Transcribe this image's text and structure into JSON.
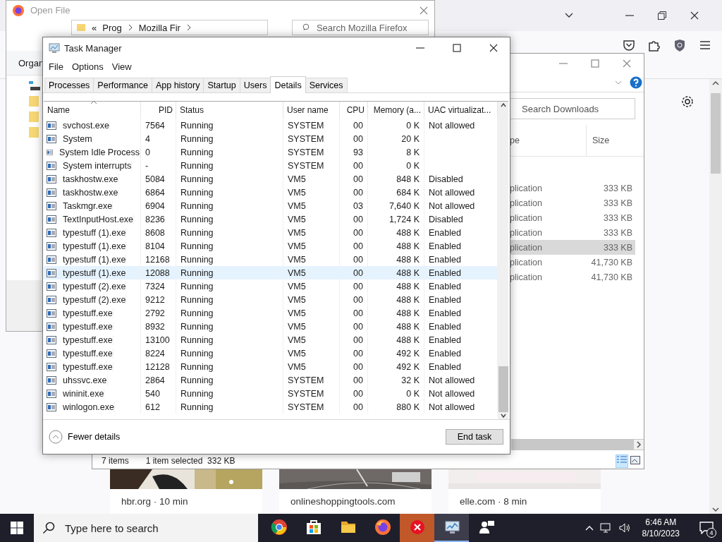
{
  "browser": {
    "cards": [
      {
        "caption": "hbr.org · 10 min"
      },
      {
        "caption": "onlineshoppingtools.com"
      },
      {
        "caption": "elle.com · 8 min"
      }
    ]
  },
  "open_file": {
    "title": "Open File",
    "path": {
      "overflow": "«",
      "segments": [
        "Prog",
        "Mozilla Fir"
      ]
    },
    "search": {
      "placeholder": "Search Mozilla Firefox"
    },
    "organize": "Organ"
  },
  "downloads": {
    "search": {
      "placeholder": "Search Downloads"
    },
    "columns": [
      "pe",
      "Size"
    ],
    "rows": [
      {
        "type": "plication",
        "size": "333 KB",
        "selected": false
      },
      {
        "type": "plication",
        "size": "333 KB",
        "selected": false
      },
      {
        "type": "plication",
        "size": "333 KB",
        "selected": false
      },
      {
        "type": "plication",
        "size": "333 KB",
        "selected": false
      },
      {
        "type": "plication",
        "size": "333 KB",
        "selected": true
      },
      {
        "type": "plication",
        "size": "41,730 KB",
        "selected": false
      },
      {
        "type": "plication",
        "size": "41,730 KB",
        "selected": false
      }
    ],
    "status": {
      "count": "7 items",
      "selection": "1 item selected  332 KB"
    }
  },
  "task_manager": {
    "title": "Task Manager",
    "menu": [
      "File",
      "Options",
      "View"
    ],
    "tabs": [
      {
        "label": "Processes",
        "selected": false
      },
      {
        "label": "Performance",
        "selected": false
      },
      {
        "label": "App history",
        "selected": false
      },
      {
        "label": "Startup",
        "selected": false
      },
      {
        "label": "Users",
        "selected": false
      },
      {
        "label": "Details",
        "selected": true
      },
      {
        "label": "Services",
        "selected": false
      }
    ],
    "columns": [
      "Name",
      "PID",
      "Status",
      "User name",
      "CPU",
      "Memory (a...",
      "UAC virtualizat..."
    ],
    "rows": [
      {
        "name": "svchost.exe",
        "pid": "7564",
        "status": "Running",
        "user": "SYSTEM",
        "cpu": "00",
        "memory": "0 K",
        "uac": "Not allowed",
        "selected": false
      },
      {
        "name": "System",
        "pid": "4",
        "status": "Running",
        "user": "SYSTEM",
        "cpu": "00",
        "memory": "20 K",
        "selected": false
      },
      {
        "name": "System Idle Process",
        "pid": "0",
        "status": "Running",
        "user": "SYSTEM",
        "cpu": "93",
        "memory": "8 K",
        "selected": false
      },
      {
        "name": "System interrupts",
        "pid": "-",
        "status": "Running",
        "user": "SYSTEM",
        "cpu": "00",
        "memory": "0 K",
        "selected": false
      },
      {
        "name": "taskhostw.exe",
        "pid": "5084",
        "status": "Running",
        "user": "VM5",
        "cpu": "00",
        "memory": "848 K",
        "uac": "Disabled",
        "selected": false
      },
      {
        "name": "taskhostw.exe",
        "pid": "6864",
        "status": "Running",
        "user": "VM5",
        "cpu": "00",
        "memory": "684 K",
        "uac": "Not allowed",
        "selected": false
      },
      {
        "name": "Taskmgr.exe",
        "pid": "6904",
        "status": "Running",
        "user": "VM5",
        "cpu": "03",
        "memory": "7,640 K",
        "uac": "Not allowed",
        "selected": false
      },
      {
        "name": "TextInputHost.exe",
        "pid": "8236",
        "status": "Running",
        "user": "VM5",
        "cpu": "00",
        "memory": "1,724 K",
        "uac": "Disabled",
        "selected": false
      },
      {
        "name": "typestuff (1).exe",
        "pid": "8608",
        "status": "Running",
        "user": "VM5",
        "cpu": "00",
        "memory": "488 K",
        "uac": "Enabled",
        "selected": false
      },
      {
        "name": "typestuff (1).exe",
        "pid": "8104",
        "status": "Running",
        "user": "VM5",
        "cpu": "00",
        "memory": "488 K",
        "uac": "Enabled",
        "selected": false
      },
      {
        "name": "typestuff (1).exe",
        "pid": "12168",
        "status": "Running",
        "user": "VM5",
        "cpu": "00",
        "memory": "488 K",
        "uac": "Enabled",
        "selected": false
      },
      {
        "name": "typestuff (1).exe",
        "pid": "12088",
        "status": "Running",
        "user": "VM5",
        "cpu": "00",
        "memory": "488 K",
        "uac": "Enabled",
        "selected": true
      },
      {
        "name": "typestuff (2).exe",
        "pid": "7324",
        "status": "Running",
        "user": "VM5",
        "cpu": "00",
        "memory": "488 K",
        "uac": "Enabled",
        "selected": false
      },
      {
        "name": "typestuff (2).exe",
        "pid": "9212",
        "status": "Running",
        "user": "VM5",
        "cpu": "00",
        "memory": "488 K",
        "uac": "Enabled",
        "selected": false
      },
      {
        "name": "typestuff.exe",
        "pid": "2792",
        "status": "Running",
        "user": "VM5",
        "cpu": "00",
        "memory": "488 K",
        "uac": "Enabled",
        "selected": false
      },
      {
        "name": "typestuff.exe",
        "pid": "8932",
        "status": "Running",
        "user": "VM5",
        "cpu": "00",
        "memory": "488 K",
        "uac": "Enabled",
        "selected": false
      },
      {
        "name": "typestuff.exe",
        "pid": "13100",
        "status": "Running",
        "user": "VM5",
        "cpu": "00",
        "memory": "488 K",
        "uac": "Enabled",
        "selected": false
      },
      {
        "name": "typestuff.exe",
        "pid": "8224",
        "status": "Running",
        "user": "VM5",
        "cpu": "00",
        "memory": "492 K",
        "uac": "Enabled",
        "selected": false
      },
      {
        "name": "typestuff.exe",
        "pid": "12128",
        "status": "Running",
        "user": "VM5",
        "cpu": "00",
        "memory": "492 K",
        "uac": "Enabled",
        "selected": false
      },
      {
        "name": "uhssvc.exe",
        "pid": "2864",
        "status": "Running",
        "user": "SYSTEM",
        "cpu": "00",
        "memory": "32 K",
        "uac": "Not allowed",
        "selected": false
      },
      {
        "name": "wininit.exe",
        "pid": "540",
        "status": "Running",
        "user": "SYSTEM",
        "cpu": "00",
        "memory": "0 K",
        "uac": "Not allowed",
        "selected": false
      },
      {
        "name": "winlogon.exe",
        "pid": "612",
        "status": "Running",
        "user": "SYSTEM",
        "cpu": "00",
        "memory": "880 K",
        "uac": "Not allowed",
        "selected": false
      }
    ],
    "fewer_details": "Fewer details",
    "end_task": "End task"
  },
  "taskbar": {
    "search": {
      "placeholder": "Type here to search"
    },
    "apps": [
      {
        "kind": "round-browser",
        "active": false
      },
      {
        "kind": "store",
        "active": false
      },
      {
        "kind": "folder",
        "active": false
      },
      {
        "kind": "fox-browser",
        "active": false
      },
      {
        "kind": "error-app",
        "active": false
      },
      {
        "kind": "monitor",
        "active": true
      },
      {
        "kind": "people",
        "active": false
      }
    ],
    "time": "6:46 AM",
    "date": "8/10/2023",
    "notifications": "4"
  }
}
